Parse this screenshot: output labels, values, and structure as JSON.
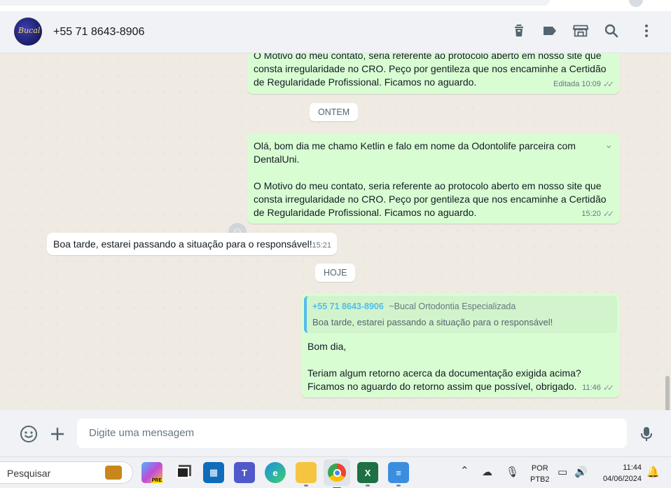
{
  "header": {
    "avatar_text": "Bucal",
    "contact_name": "+55 71 8643-8906",
    "icons": [
      "delete-icon",
      "label-icon",
      "store-icon",
      "search-icon",
      "menu-icon"
    ]
  },
  "messages": {
    "m1": {
      "lines": [
        "O Motivo do meu contato, seria referente ao protocolo aberto em nosso site que",
        "consta irregularidade no CRO. Peço por gentileza que nos encaminhe a Certidão",
        "de Regularidade Profissional. Ficamos no aguardo."
      ],
      "edited": "Editada",
      "time": "10:09"
    },
    "chip_yesterday": "ONTEM",
    "m2": {
      "line1": "Olá, bom dia me chamo Ketlin e falo em nome da Odontolife parceira com",
      "line2": "DentalUni.",
      "line3": "O Motivo do meu contato, seria referente ao protocolo aberto em nosso site que",
      "line4": "consta irregularidade no CRO. Peço por gentileza que nos encaminhe a Certidão",
      "line5": "de Regularidade Profissional. Ficamos no aguardo.",
      "time": "15:20"
    },
    "m3": {
      "text": "Boa tarde, estarei passando a situação para o responsável!",
      "time": "15:21"
    },
    "chip_today": "HOJE",
    "m4": {
      "quote_number": "+55 71 8643-8906",
      "quote_name": "~Bucal Ortodontia Especializada",
      "quote_text": "Boa tarde, estarei passando a situação para o responsável!",
      "line1": "Bom dia,",
      "line2": "Teriam algum retorno acerca da documentação exigida acima?",
      "line3": "Ficamos no aguardo do retorno assim que possível, obrigado.",
      "time": "11:46"
    }
  },
  "composer": {
    "placeholder": "Digite uma mensagem"
  },
  "taskbar": {
    "search_label": "Pesquisar",
    "lang_top": "POR",
    "lang_bottom": "PTB2",
    "clock_time": "11:44",
    "clock_date": "04/06/2024",
    "copilot_badge": "PRE"
  }
}
